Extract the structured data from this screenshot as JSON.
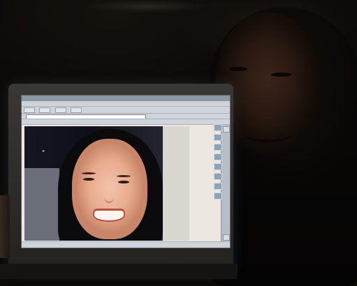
{
  "scene": {
    "description_colors": {
      "background": "#0c0a08",
      "screen_bezel": "#2f2d29",
      "browser_chrome": "#cfd4da",
      "photo_skin": "#efb89d"
    }
  }
}
